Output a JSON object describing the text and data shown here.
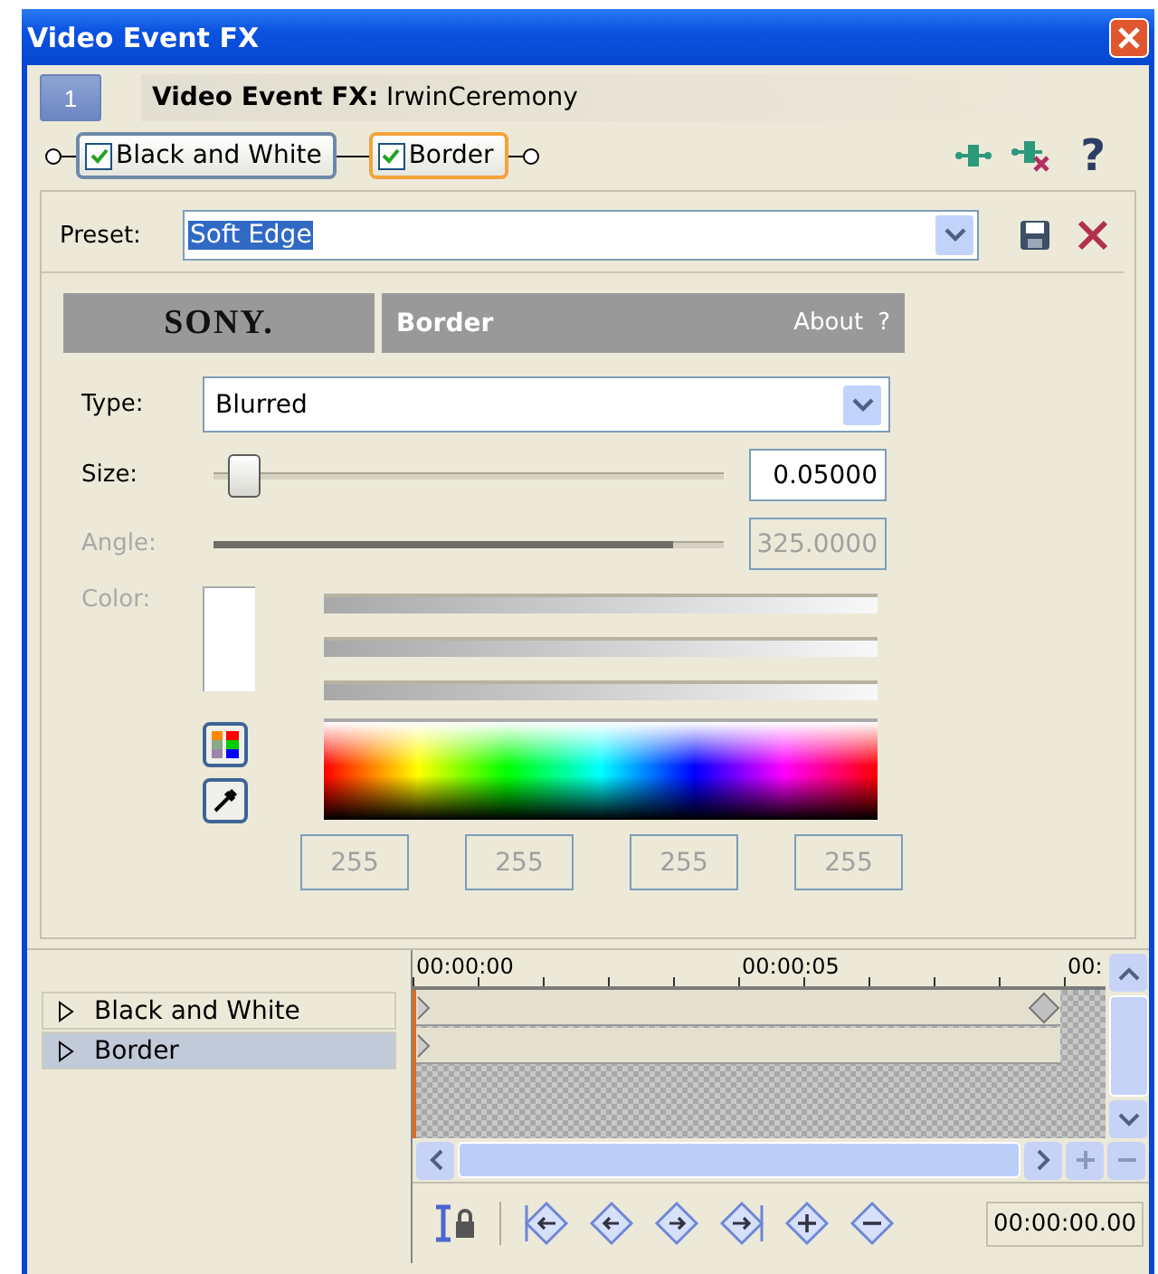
{
  "window": {
    "title": "Video Event FX"
  },
  "header": {
    "badge": "1",
    "title": "**Video Event FX:** IrwinCeremony"
  },
  "chain": [
    {
      "label": "Black and White",
      "checked": true,
      "selected": false
    },
    {
      "label": "Border",
      "checked": true,
      "selected": true
    }
  ],
  "chain_help": "?",
  "preset": {
    "label": "Preset:",
    "value": "Soft Edge"
  },
  "plugin": {
    "logo": "SONY.",
    "name": "Border",
    "about": "About",
    "help": "?"
  },
  "type": {
    "label": "Type:",
    "value": "Blurred"
  },
  "sliders": [
    {
      "label": "Size:",
      "level": 0.03,
      "value": "0.05000",
      "disabled": false
    },
    {
      "label": "Angle:",
      "level": 0.9,
      "value": "325.0000",
      "disabled": true
    }
  ],
  "color": {
    "label": "Color:",
    "disabled": true,
    "bars": [
      {
        "level": 1
      },
      {
        "level": 1
      },
      {
        "level": 1
      }
    ],
    "channels": [
      "255",
      "255",
      "255",
      "255"
    ]
  },
  "tracks": [
    {
      "label": "Black and White",
      "selected": false,
      "expanded": false
    },
    {
      "label": "Border",
      "selected": true,
      "expanded": false
    }
  ],
  "timeline": {
    "ticks": [
      "00:00:00",
      "00:00:05",
      "00:"
    ],
    "time": "00:00:00.00"
  }
}
